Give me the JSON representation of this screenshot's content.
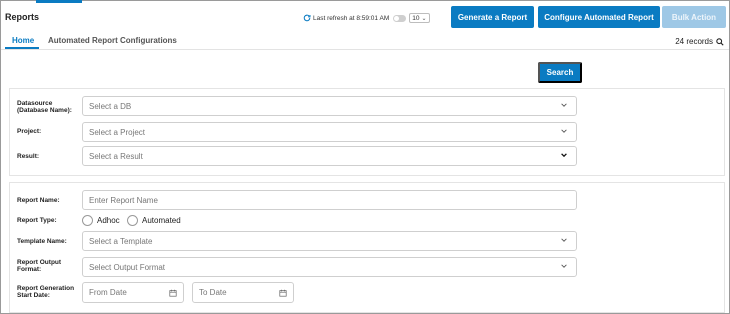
{
  "header": {
    "page_title": "Reports",
    "refresh_text": "Last refresh at 8:59:01 AM",
    "page_size": "10",
    "buttons": {
      "generate": "Generate a Report",
      "configure": "Configure Automated Report",
      "bulk": "Bulk Action"
    },
    "accent_color": "#0a7bc2",
    "disabled_color": "#9ec8e6"
  },
  "tabs": [
    {
      "label": "Home",
      "active": true
    },
    {
      "label": "Automated Report Configurations",
      "active": false
    }
  ],
  "records_text": "24 records",
  "search_button": "Search",
  "filters": {
    "datasource": {
      "label": "Datasource (Database Name):",
      "placeholder": "Select a DB"
    },
    "project": {
      "label": "Project:",
      "placeholder": "Select a Project"
    },
    "result": {
      "label": "Result:",
      "placeholder": "Select a Result"
    }
  },
  "report_form": {
    "report_name": {
      "label": "Report Name:",
      "placeholder": "Enter Report Name"
    },
    "report_type": {
      "label": "Report Type:",
      "options": [
        "Adhoc",
        "Automated"
      ]
    },
    "template_name": {
      "label": "Template Name:",
      "placeholder": "Select a Template"
    },
    "output_format": {
      "label": "Report Output Format:",
      "placeholder": "Select Output Format"
    },
    "start_date": {
      "label": "Report Generation Start Date:",
      "from_placeholder": "From Date",
      "to_placeholder": "To Date"
    }
  },
  "icons": {
    "refresh": "refresh-icon",
    "search": "search-icon",
    "chevron": "chevron-down-icon",
    "calendar": "calendar-icon"
  }
}
